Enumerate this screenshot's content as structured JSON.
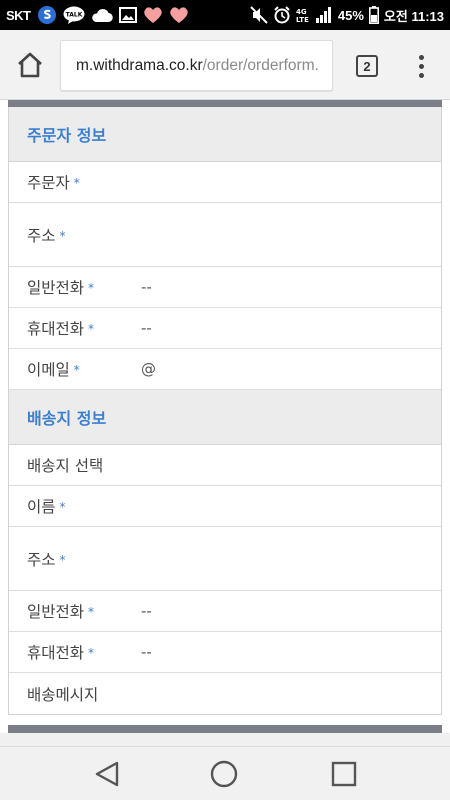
{
  "status_bar": {
    "carrier": "SKT",
    "battery": "45%",
    "time": "오전 11:13",
    "icons": [
      "s-app-icon",
      "talk-icon",
      "cloud-icon",
      "gallery-icon",
      "heart-icon",
      "heart-icon",
      "mute-icon",
      "alarm-icon",
      "lte-icon",
      "signal-icon",
      "battery-icon"
    ]
  },
  "browser": {
    "url_host": "m.withdrama.co.kr",
    "url_path": "/order/orderform.",
    "tab_count": "2",
    "icons": [
      "home-icon",
      "more-icon"
    ]
  },
  "orderer_section": {
    "title": "주문자 정보",
    "fields": [
      {
        "label": "주문자",
        "required": "*",
        "value": ""
      },
      {
        "label": "주소",
        "required": "*",
        "value": ""
      },
      {
        "label": "일반전화",
        "required": "*",
        "value": "--"
      },
      {
        "label": "휴대전화",
        "required": "*",
        "value": "--"
      },
      {
        "label": "이메일",
        "required": "*",
        "value": "@"
      }
    ]
  },
  "shipping_section": {
    "title": "배송지 정보",
    "fields": [
      {
        "label": "배송지 선택",
        "required": "",
        "value": ""
      },
      {
        "label": "이름",
        "required": "*",
        "value": ""
      },
      {
        "label": "주소",
        "required": "*",
        "value": ""
      },
      {
        "label": "일반전화",
        "required": "*",
        "value": "--"
      },
      {
        "label": "휴대전화",
        "required": "*",
        "value": "--"
      },
      {
        "label": "배송메시지",
        "required": "",
        "value": ""
      }
    ]
  },
  "nav_bar": {
    "icons": [
      "back-icon",
      "home-circle-icon",
      "recents-icon"
    ]
  },
  "colors": {
    "accent": "#3d7fcf",
    "section_bg": "#ececec",
    "strip": "#7a7f87"
  }
}
